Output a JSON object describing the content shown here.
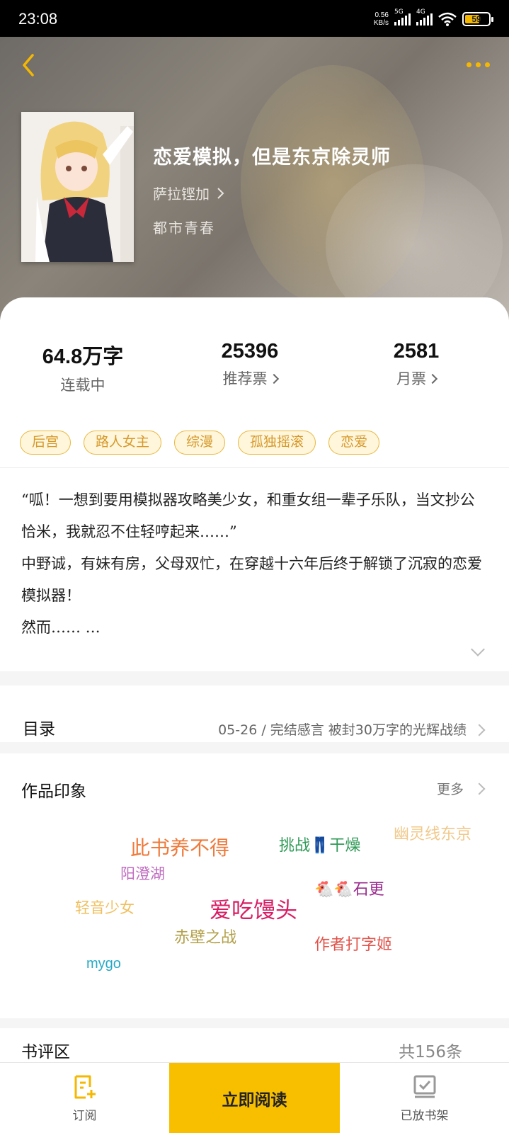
{
  "status_bar": {
    "time": "23:08",
    "net_speed_value": "0.56",
    "net_speed_unit": "KB/s",
    "sim1_label": "5G",
    "sim2_label": "4G",
    "battery": "59"
  },
  "book": {
    "title": "恋爱模拟，但是东京除灵师",
    "author": "萨拉铿加",
    "genre": "都市青春"
  },
  "stats": [
    {
      "value": "64.8万字",
      "label": "连载中"
    },
    {
      "value": "25396",
      "label": "推荐票"
    },
    {
      "value": "2581",
      "label": "月票"
    }
  ],
  "tags": [
    "后宫",
    "路人女主",
    "综漫",
    "孤独摇滚",
    "恋爱"
  ],
  "synopsis": {
    "p1": "“呱！一想到要用模拟器攻略美少女，和重女组一辈子乐队，当文抄公恰米，我就忍不住轻哼起来……”",
    "p2": "中野诚，有妹有房，父母双忙，在穿越十六年后终于解锁了沉寂的恋爱模拟器！",
    "p3": "然而…… …"
  },
  "toc": {
    "title": "目录",
    "latest": "05-26 / 完结感言 被封30万字的光辉战绩"
  },
  "impressions": {
    "title": "作品印象",
    "more": "更多",
    "words": [
      {
        "text": "幽灵线东京",
        "color": "#f1c98a"
      },
      {
        "text": "此书养不得",
        "color": "#ef7a3a"
      },
      {
        "text": "挑战👖干燥",
        "color": "#2f9a57"
      },
      {
        "text": "阳澄湖",
        "color": "#c06cc0"
      },
      {
        "text": "🐔🐔石更",
        "color": "#9b2b8f"
      },
      {
        "text": "轻音少女",
        "color": "#f0c060"
      },
      {
        "text": "爱吃馒头",
        "color": "#d81e63"
      },
      {
        "text": "赤壁之战",
        "color": "#b3a04a"
      },
      {
        "text": "作者打字姬",
        "color": "#e2534a"
      },
      {
        "text": "mygo",
        "color": "#27a9c4"
      }
    ]
  },
  "reviews": {
    "title": "书评区",
    "count": "共156条"
  },
  "bottom_bar": {
    "subscribe": "订阅",
    "read_now": "立即阅读",
    "shelf": "已放书架"
  },
  "colors": {
    "accent": "#f7bf00",
    "tag_text": "#d6992a",
    "tag_border": "#e9b73a"
  }
}
